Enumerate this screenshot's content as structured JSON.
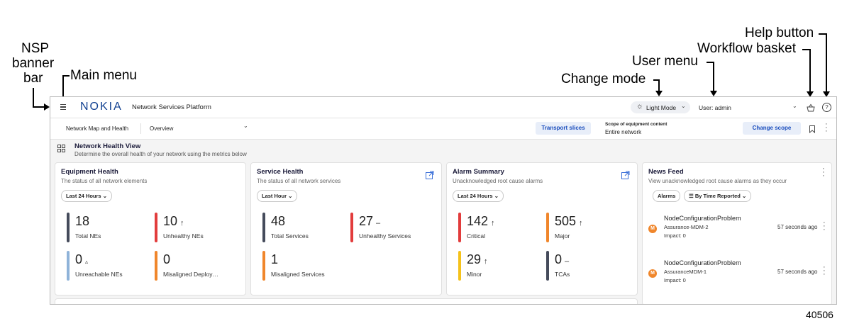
{
  "annotations": {
    "nsp_banner_bar": [
      "NSP",
      "banner",
      "bar"
    ],
    "main_menu": "Main menu",
    "change_mode": "Change mode",
    "user_menu": "User menu",
    "workflow_basket": "Workflow basket",
    "help_button": "Help button",
    "figure_id": "40506"
  },
  "banner": {
    "logo": "NOKIA",
    "app_title": "Network Services Platform",
    "mode_label": "Light Mode",
    "user_label": "User: admin"
  },
  "subbar": {
    "crumb1": "Network Map and Health",
    "crumb2": "Overview",
    "transport_slices": "Transport slices",
    "scope_label": "Scope of equipment content",
    "scope_value": "Entire network",
    "change_scope": "Change scope"
  },
  "view": {
    "title": "Network Health View",
    "description": "Determine the overall health of your network using the metrics below"
  },
  "equipment": {
    "title": "Equipment Health",
    "desc": "The status of all network elements",
    "filter": "Last 24 Hours",
    "metrics": [
      {
        "value": "18",
        "trend": "",
        "label": "Total NEs",
        "color": "#454b5b"
      },
      {
        "value": "10",
        "trend": "↑",
        "label": "Unhealthy NEs",
        "color": "#e23c3c"
      },
      {
        "value": "0",
        "trend": "▵",
        "label": "Unreachable NEs",
        "color": "#8fb3d9"
      },
      {
        "value": "0",
        "trend": "",
        "label": "Misaligned Deploy…",
        "color": "#f0862b"
      }
    ]
  },
  "service": {
    "title": "Service Health",
    "desc": "The status of all network services",
    "filter": "Last Hour",
    "metrics": [
      {
        "value": "48",
        "trend": "",
        "label": "Total Services",
        "color": "#454b5b"
      },
      {
        "value": "27",
        "trend": "–",
        "label": "Unhealthy Services",
        "color": "#e23c3c"
      },
      {
        "value": "1",
        "trend": "",
        "label": "Misaligned Services",
        "color": "#f0862b"
      }
    ]
  },
  "alarm": {
    "title": "Alarm Summary",
    "desc": "Unacknowledged root cause alarms",
    "filter": "Last 24 Hours",
    "metrics": [
      {
        "value": "142",
        "trend": "↑",
        "label": "Critical",
        "color": "#e23c3c"
      },
      {
        "value": "505",
        "trend": "↑",
        "label": "Major",
        "color": "#f0862b"
      },
      {
        "value": "29",
        "trend": "↑",
        "label": "Minor",
        "color": "#f5c21b"
      },
      {
        "value": "0",
        "trend": "–",
        "label": "TCAs",
        "color": "#454b5b"
      }
    ]
  },
  "news": {
    "title": "News Feed",
    "desc": "View unacknowledged root cause alarms as they occur",
    "filter_alarms": "Alarms",
    "filter_sort": "By Time Reported",
    "items": [
      {
        "badge": "M",
        "title": "NodeConfigurationProblem",
        "source": "Assurance-MDM-2",
        "impact": "Impact: 0",
        "time": "57 seconds ago"
      },
      {
        "badge": "M",
        "title": "NodeConfigurationProblem",
        "source": "AssuranceMDM-1",
        "impact": "Impact: 0",
        "time": "57 seconds ago"
      }
    ]
  },
  "colors": {
    "brand": "#124191",
    "accent": "#1a4dbd",
    "badge": "#f0862b"
  }
}
